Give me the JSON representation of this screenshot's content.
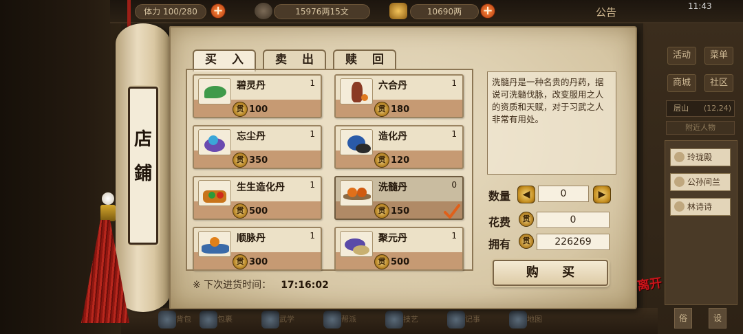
{
  "hud": {
    "stamina": "体力 100/280",
    "money": "15976两15文",
    "gold": "10690两",
    "announcement": "公告",
    "clock": "11:43"
  },
  "side": {
    "buttons": [
      "活动",
      "菜单",
      "商城",
      "社区"
    ],
    "location": "层山",
    "coords": "(12,24)",
    "nearby": "附近人物",
    "npcs": [
      "玲珑殿",
      "公孙间兰",
      "林诗诗"
    ]
  },
  "bottom": {
    "items": [
      "背包",
      "包裹",
      "武学",
      "帮派",
      "技艺",
      "记事",
      "地图"
    ],
    "corner": [
      "俗",
      "设"
    ]
  },
  "shop": {
    "title": "店鋪",
    "tabs": [
      "买 入",
      "卖 出",
      "赎 回"
    ],
    "items": [
      {
        "name": "碧灵丹",
        "qty": "1",
        "price": "100"
      },
      {
        "name": "六合丹",
        "qty": "1",
        "price": "180"
      },
      {
        "name": "忘尘丹",
        "qty": "1",
        "price": "350"
      },
      {
        "name": "造化丹",
        "qty": "1",
        "price": "120"
      },
      {
        "name": "生生造化丹",
        "qty": "1",
        "price": "500"
      },
      {
        "name": "洗髓丹",
        "qty": "0",
        "price": "150"
      },
      {
        "name": "顺脉丹",
        "qty": "1",
        "price": "300"
      },
      {
        "name": "聚元丹",
        "qty": "1",
        "price": "500"
      }
    ],
    "selected_index": 5,
    "coin_glyph": "贯",
    "restock_label": "※ 下次进货时间：",
    "restock_time": "17:16:02",
    "description": "洗髓丹是一种名贵的丹药，据说可洗髓伐脉，改变服用之人的资质和天赋，对于习武之人非常有用处。",
    "quantity_label": "数量",
    "quantity_value": "0",
    "cost_label": "花费",
    "cost_value": "0",
    "own_label": "拥有",
    "own_value": "226269",
    "buy_label": "购 买",
    "leave_label": "离开"
  },
  "colors": {
    "panel_bg": "#ddd0b2",
    "price_band": "#c69a73",
    "tassel_red": "#9c1f17",
    "leave_red": "#c8141a",
    "check_orange": "#e0601a"
  }
}
